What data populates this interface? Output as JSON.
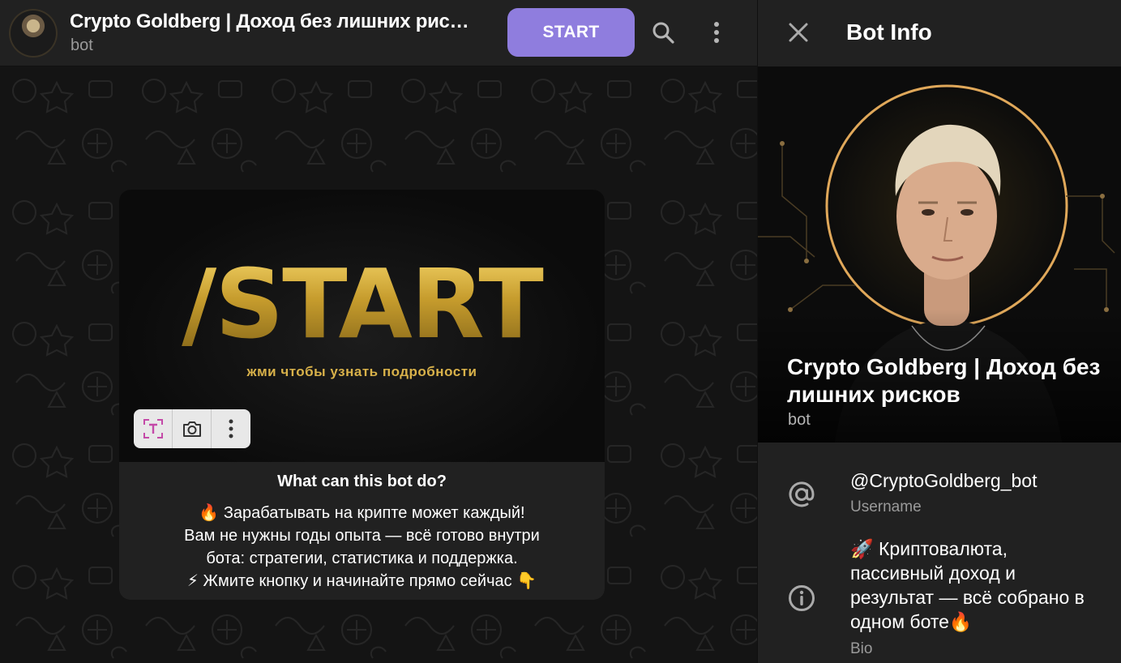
{
  "chat": {
    "title": "Crypto Goldberg | Доход без лишних рис…",
    "subtitle": "bot",
    "start_button": "START"
  },
  "message": {
    "image_headline": "/START",
    "image_caption": "жми чтобы узнать подробности",
    "title": "What can this bot do?",
    "lines": [
      "🔥 Зарабатывать на крипте может каждый!",
      "Вам не нужны годы опыта — всё готово внутри",
      "бота: стратегии, статистика и поддержка.",
      "⚡ Жмите кнопку и начинайте прямо сейчас 👇"
    ]
  },
  "panel": {
    "title": "Bot Info",
    "name_line1": "Crypto Goldberg | Доход без",
    "name_line2": "лишних рисков",
    "subtitle": "bot",
    "username": "@CryptoGoldberg_bot",
    "username_label": "Username",
    "bio_lines": [
      "🚀 Криптовалюта,",
      "пассивный доход и",
      "результат — всё собрано в",
      "одном боте🔥"
    ],
    "bio_label": "Bio"
  },
  "icons": {
    "search": "search-icon",
    "more": "more-vertical-icon",
    "close": "close-icon",
    "username": "at-sign-icon",
    "bio": "info-icon",
    "toolbar": [
      "text-recognition-icon",
      "camera-icon",
      "more-vertical-icon"
    ]
  },
  "colors": {
    "accent": "#8f7dde",
    "header_bg": "#212121",
    "chat_bg": "#141414",
    "gold": "#c9a33a"
  }
}
